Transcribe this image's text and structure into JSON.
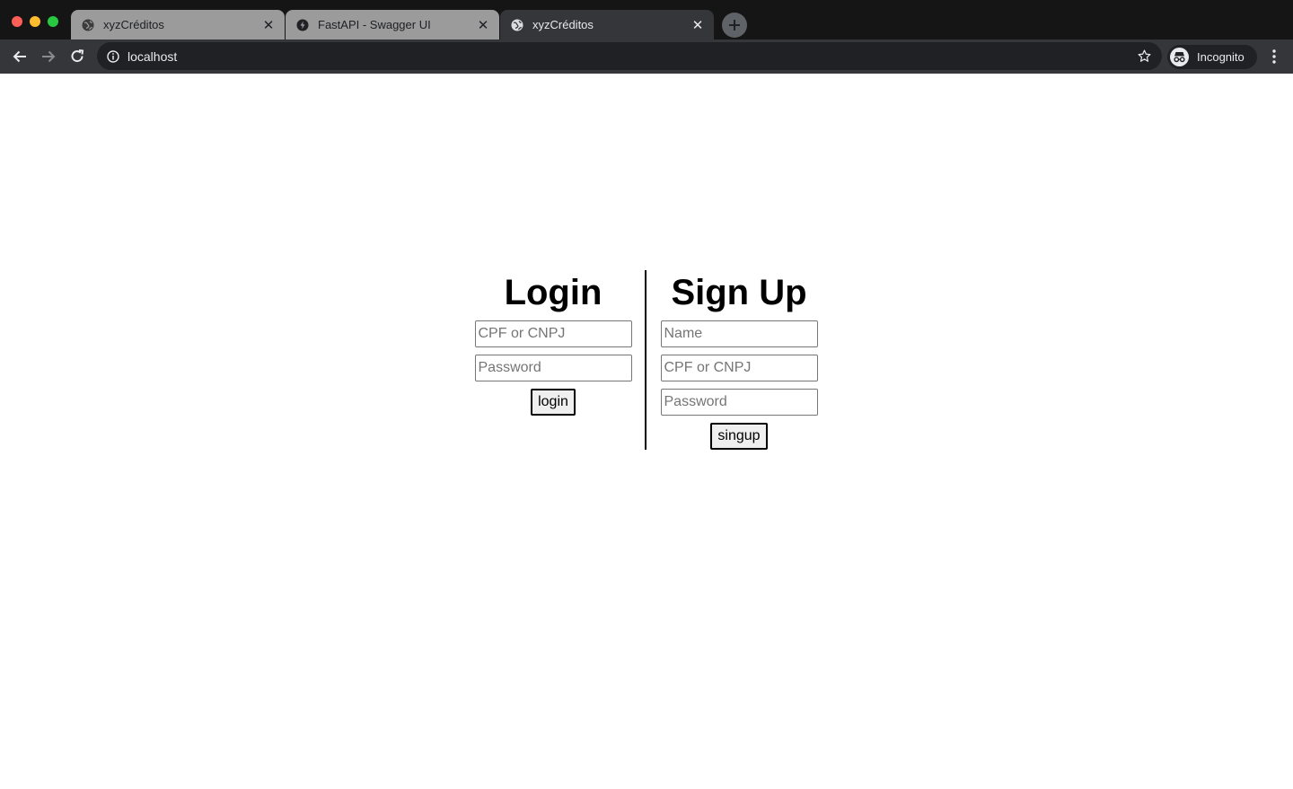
{
  "browser": {
    "tabs": [
      {
        "title": "xyzCréditos",
        "favicon": "globe-icon",
        "active": false
      },
      {
        "title": "FastAPI - Swagger UI",
        "favicon": "fastapi-bolt-icon",
        "active": false
      },
      {
        "title": "xyzCréditos",
        "favicon": "globe-icon",
        "active": true
      }
    ],
    "close_glyph": "✕",
    "url": "localhost",
    "profile_label": "Incognito"
  },
  "login": {
    "heading": "Login",
    "cpf_placeholder": "CPF or CNPJ",
    "password_placeholder": "Password",
    "button_label": "login"
  },
  "signup": {
    "heading": "Sign Up",
    "name_placeholder": "Name",
    "cpf_placeholder": "CPF or CNPJ",
    "password_placeholder": "Password",
    "button_label": "singup"
  },
  "colors": {
    "tabstrip": "#151515",
    "toolbar": "#35363a",
    "inactive_tab": "#9b9b9b",
    "page_background": "#ffffff",
    "divider": "#000000"
  }
}
